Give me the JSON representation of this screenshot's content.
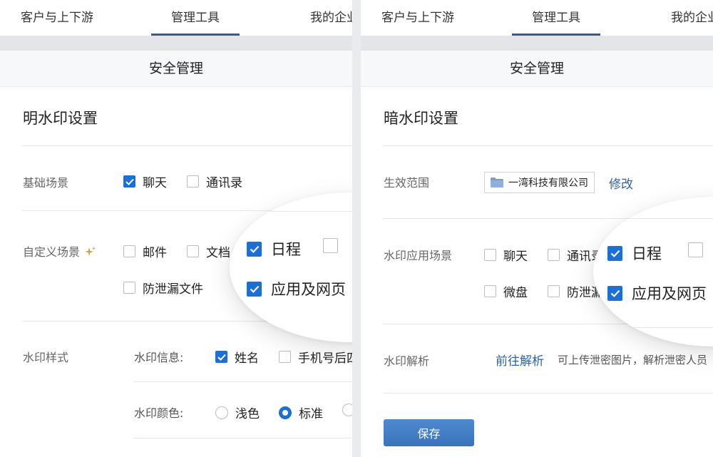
{
  "tabs": {
    "items": [
      "客户与上下游",
      "管理工具",
      "我的企业"
    ],
    "active": "管理工具"
  },
  "section_title": "安全管理",
  "left": {
    "heading": "明水印设置",
    "basic_scene": {
      "label": "基础场景",
      "options": [
        {
          "label": "聊天",
          "checked": true
        },
        {
          "label": "通讯录",
          "checked": false
        }
      ]
    },
    "custom_scene": {
      "label": "自定义场景",
      "icon": "sparkle-icon",
      "options": [
        {
          "label": "邮件",
          "checked": false
        },
        {
          "label": "文档",
          "checked": false
        },
        {
          "label": "防泄漏文件",
          "checked": false
        }
      ],
      "zoom_options": [
        {
          "label": "日程",
          "checked": true
        },
        {
          "label": "应用及网页",
          "checked": true
        }
      ]
    },
    "style": {
      "label": "水印样式",
      "info_label": "水印信息:",
      "info_options": [
        {
          "label": "姓名",
          "checked": true
        },
        {
          "label": "手机号后四位",
          "checked": false
        }
      ],
      "color_label": "水印颜色:",
      "color_options": [
        {
          "label": "浅色",
          "selected": false
        },
        {
          "label": "标准",
          "selected": true
        }
      ]
    }
  },
  "right": {
    "heading": "暗水印设置",
    "scope": {
      "label": "生效范围",
      "value": "一湾科技有限公司",
      "edit": "修改",
      "icon": "folder-icon"
    },
    "scene": {
      "label": "水印应用场景",
      "options": [
        {
          "label": "聊天",
          "checked": false
        },
        {
          "label": "通讯录",
          "checked": false
        },
        {
          "label": "微盘",
          "checked": false
        },
        {
          "label": "防泄漏文件",
          "checked": false
        }
      ],
      "zoom_options": [
        {
          "label": "日程",
          "checked": true
        },
        {
          "label": "应用及网页",
          "checked": true
        }
      ]
    },
    "parse": {
      "label": "水印解析",
      "link": "前往解析",
      "desc": "可上传泄密图片，解析泄密人员"
    },
    "save": "保存"
  },
  "colors": {
    "accent": "#1d6fd3",
    "link": "#2d62a8",
    "tab_indicator": "#3a5a8a",
    "button": "#3f7bc4"
  }
}
